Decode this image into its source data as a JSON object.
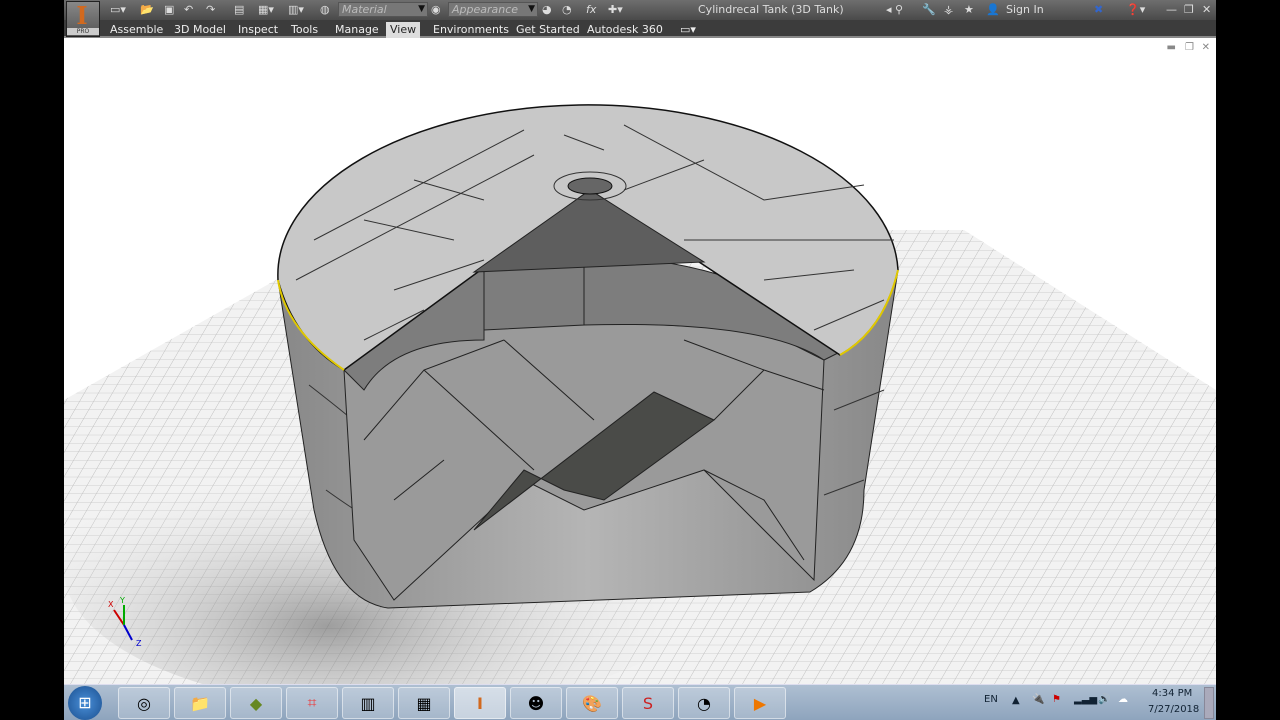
{
  "titlebar": {
    "title": "Cylindrecal Tank (3D Tank)",
    "sign_in": "Sign In",
    "material_placeholder": "Material",
    "appearance_placeholder": "Appearance",
    "fx": "fx",
    "logo_badge": "PRO"
  },
  "ribbon": {
    "tabs": [
      "Assemble",
      "3D Model",
      "Inspect",
      "Tools",
      "Manage",
      "View",
      "Environments",
      "Get Started",
      "Autodesk 360"
    ],
    "active_tab": "View"
  },
  "viewcube": {
    "x": "X",
    "y": "Y",
    "z": "Z"
  },
  "taskbar": {
    "language": "EN",
    "time": "4:34 PM",
    "date": "7/27/2018"
  },
  "colors": {
    "accent": "#d2691e",
    "titlebar": "#5a5a5a",
    "ribbon": "#3c3c3c",
    "taskbar": "#9fb3c9"
  }
}
